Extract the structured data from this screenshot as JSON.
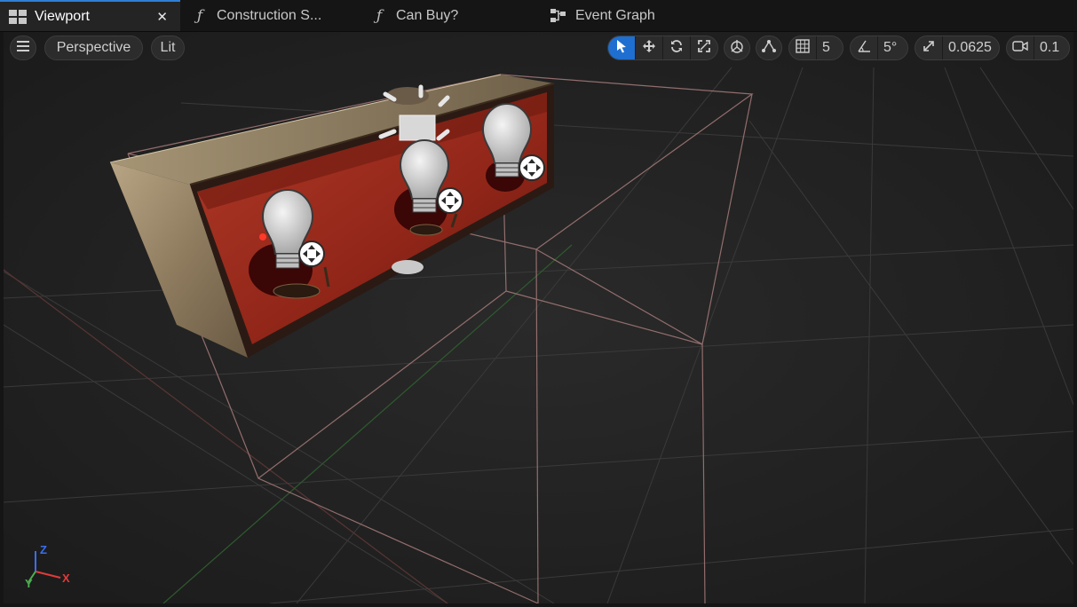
{
  "tabs": [
    {
      "label": "Viewport",
      "icon": "viewport-grid-icon",
      "active": true
    },
    {
      "label": "Construction S...",
      "icon": "function-icon",
      "active": false
    },
    {
      "label": "Can Buy?",
      "icon": "function-icon",
      "active": false
    },
    {
      "label": "Event Graph",
      "icon": "event-graph-icon",
      "active": false
    }
  ],
  "tab_close_glyph": "✕",
  "toolbar": {
    "view_mode": "Perspective",
    "lighting_mode": "Lit",
    "grid_snap_value": "5",
    "rotation_snap_value": "5°",
    "scale_snap_value": "0.0625",
    "camera_speed_value": "0.1"
  },
  "axis_gizmo": {
    "z": "Z",
    "y": "Y",
    "x": "X"
  },
  "colors": {
    "accent": "#1e6fcf",
    "background": "#232323",
    "bounds_box": "#a77a7a",
    "axis_x": "#e03a3a",
    "axis_y": "#4caf50",
    "axis_z": "#3a6ef0"
  }
}
